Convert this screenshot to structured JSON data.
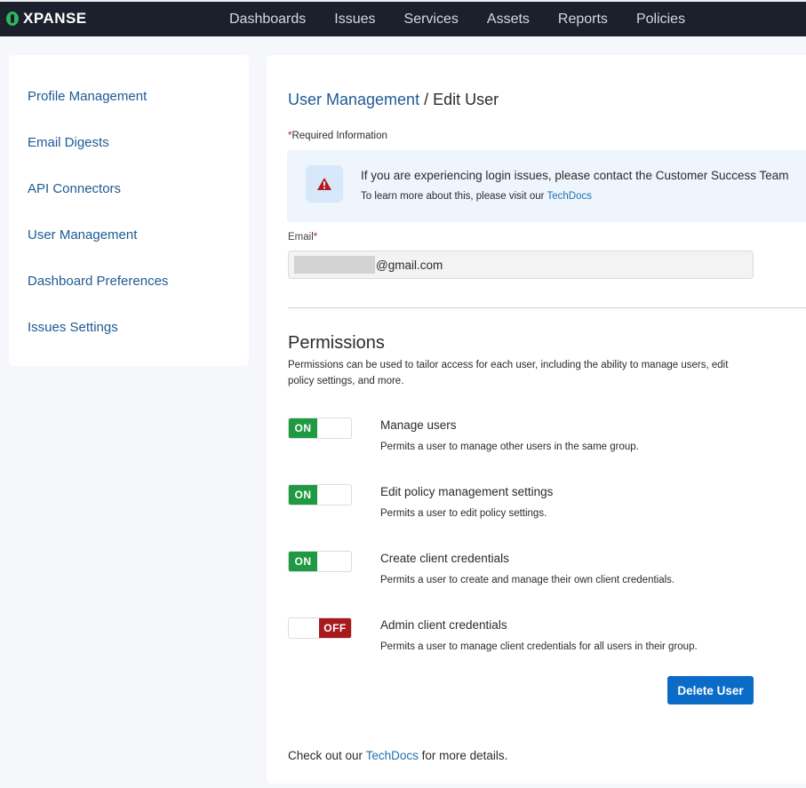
{
  "app": {
    "logo_text": "XPANSE",
    "brand_color": "#2fb55f"
  },
  "nav": {
    "items": [
      {
        "label": "Dashboards"
      },
      {
        "label": "Issues"
      },
      {
        "label": "Services"
      },
      {
        "label": "Assets"
      },
      {
        "label": "Reports"
      },
      {
        "label": "Policies"
      }
    ]
  },
  "sidebar": {
    "items": [
      {
        "label": "Profile Management"
      },
      {
        "label": "Email Digests"
      },
      {
        "label": "API Connectors"
      },
      {
        "label": "User Management"
      },
      {
        "label": "Dashboard Preferences"
      },
      {
        "label": "Issues Settings"
      }
    ]
  },
  "breadcrumb": {
    "parent": "User Management",
    "separator": " / ",
    "current": "Edit User"
  },
  "form": {
    "required_asterisk": "*",
    "required_label": "Required Information",
    "email_label": "Email",
    "email_value": "@gmail.com"
  },
  "notice": {
    "icon": "warning-icon",
    "title": "If you are experiencing login issues, please contact the Customer Success Team",
    "sub_prefix": "To learn more about this, please visit our ",
    "sub_link": "TechDocs"
  },
  "permissions": {
    "title": "Permissions",
    "description": "Permissions can be used to tailor access for each user, including the ability to manage users, edit policy settings, and more.",
    "items": [
      {
        "name": "Manage users",
        "help": "Permits a user to manage other users in the same group.",
        "state": "ON",
        "enabled": true
      },
      {
        "name": "Edit policy management settings",
        "help": "Permits a user to edit policy settings.",
        "state": "ON",
        "enabled": true
      },
      {
        "name": "Create client credentials",
        "help": "Permits a user to create and manage their own client credentials.",
        "state": "ON",
        "enabled": true
      },
      {
        "name": "Admin client credentials",
        "help": "Permits a user to manage client credentials for all users in their group.",
        "state": "OFF",
        "enabled": false
      }
    ],
    "on_color": "#1f9a42",
    "off_color": "#a8191d"
  },
  "actions": {
    "delete_label": "Delete User",
    "delete_color": "#0b6cc8"
  },
  "footer": {
    "prefix": "Check out our ",
    "link": "TechDocs",
    "suffix": " for more details."
  }
}
